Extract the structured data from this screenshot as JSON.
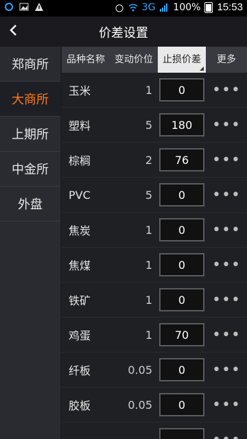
{
  "status": {
    "network": "3G",
    "battery": "100%",
    "time": "15:53"
  },
  "header": {
    "title": "价差设置"
  },
  "sidebar": {
    "items": [
      {
        "label": "郑商所",
        "active": false
      },
      {
        "label": "大商所",
        "active": true
      },
      {
        "label": "上期所",
        "active": false
      },
      {
        "label": "中金所",
        "active": false
      },
      {
        "label": "外盘",
        "active": false
      }
    ]
  },
  "table": {
    "headers": {
      "name": "品种名称",
      "tick": "变动价位",
      "stop": "止损价差",
      "more": "更多"
    },
    "rows": [
      {
        "name": "玉米",
        "tick": "1",
        "value": "0"
      },
      {
        "name": "塑料",
        "tick": "5",
        "value": "180"
      },
      {
        "name": "棕榈",
        "tick": "2",
        "value": "76"
      },
      {
        "name": "PVC",
        "tick": "5",
        "value": "0"
      },
      {
        "name": "焦炭",
        "tick": "1",
        "value": "0"
      },
      {
        "name": "焦煤",
        "tick": "1",
        "value": "0"
      },
      {
        "name": "铁矿",
        "tick": "1",
        "value": "0"
      },
      {
        "name": "鸡蛋",
        "tick": "1",
        "value": "70"
      },
      {
        "name": "纤板",
        "tick": "0.05",
        "value": "0"
      },
      {
        "name": "胶板",
        "tick": "0.05",
        "value": "0"
      },
      {
        "name": "",
        "tick": "",
        "value": ""
      }
    ]
  },
  "colors": {
    "accent": "#ff7a1a",
    "header_bg": "#383a3f",
    "active_header": "#e9e9e9"
  }
}
